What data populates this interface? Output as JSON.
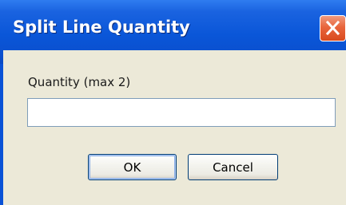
{
  "window": {
    "title": "Split Line Quantity"
  },
  "titlebar": {
    "close_icon": "close-icon"
  },
  "form": {
    "quantity_label": "Quantity (max 2)",
    "quantity_value": "",
    "quantity_placeholder": ""
  },
  "buttons": {
    "ok_label": "OK",
    "cancel_label": "Cancel"
  },
  "colors": {
    "titlebar": "#0a56d8",
    "close_button": "#e8653c",
    "dialog_background": "#ece9d8",
    "input_border": "#7f9db9",
    "button_border": "#003c74"
  }
}
